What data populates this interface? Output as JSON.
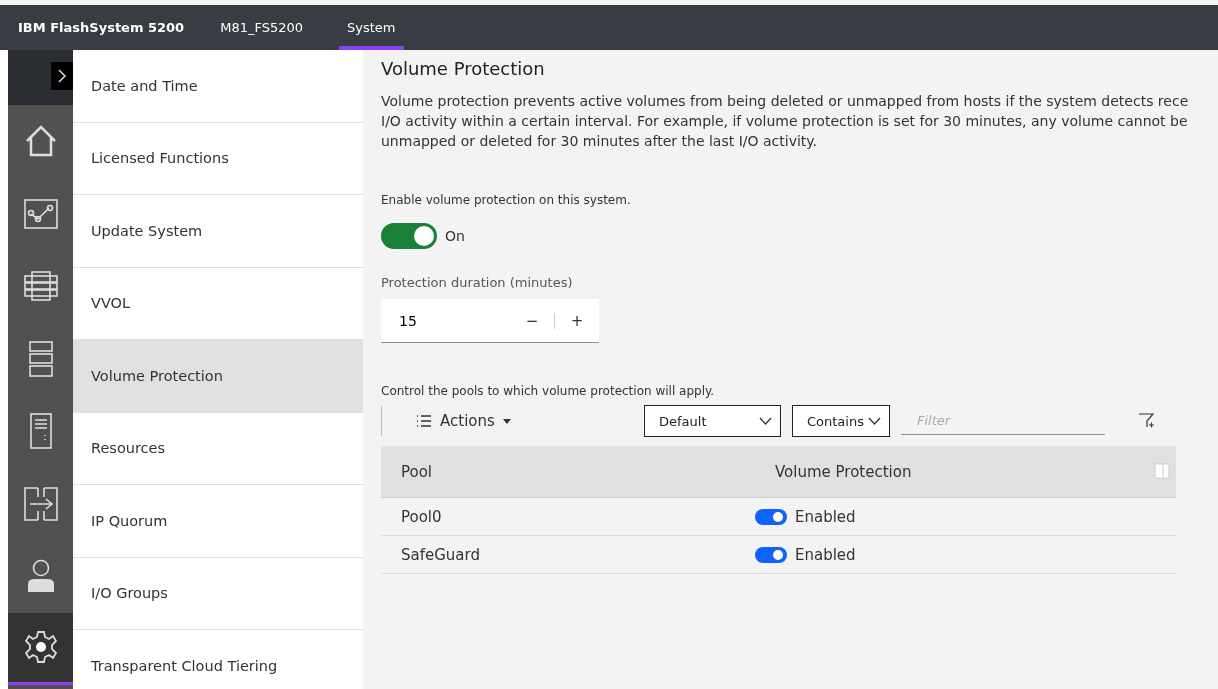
{
  "top_bar": {
    "product": "IBM FlashSystem 5200",
    "system_name": "M81_FS5200",
    "tabs": [
      {
        "label": "System",
        "selected": true
      }
    ]
  },
  "rail": {
    "items": [
      {
        "kind": "home",
        "selected": false
      },
      {
        "kind": "monitoring",
        "selected": false
      },
      {
        "kind": "pools",
        "selected": false
      },
      {
        "kind": "volumes",
        "selected": false
      },
      {
        "kind": "hosts",
        "selected": false
      },
      {
        "kind": "copy",
        "selected": false
      },
      {
        "kind": "access",
        "selected": false
      },
      {
        "kind": "settings",
        "selected": true
      }
    ]
  },
  "nav": {
    "items": [
      {
        "label": "Date and Time",
        "selected": false
      },
      {
        "label": "Licensed Functions",
        "selected": false
      },
      {
        "label": "Update System",
        "selected": false
      },
      {
        "label": "VVOL",
        "selected": false
      },
      {
        "label": "Volume Protection",
        "selected": true
      },
      {
        "label": "Resources",
        "selected": false
      },
      {
        "label": "IP Quorum",
        "selected": false
      },
      {
        "label": "I/O Groups",
        "selected": false
      },
      {
        "label": "Transparent Cloud Tiering",
        "selected": false
      }
    ]
  },
  "content": {
    "title": "Volume Protection",
    "description_lines": [
      "Volume protection prevents active volumes from being deleted or unmapped from hosts if the system detects rece",
      "I/O activity within a certain interval. For example, if volume protection is set for 30 minutes, any volume cannot be",
      "unmapped or deleted for 30 minutes after the last I/O activity."
    ],
    "enable_label": "Enable volume protection on this system.",
    "toggle": {
      "on": true,
      "label": "On"
    },
    "duration": {
      "label": "Protection duration (minutes)",
      "value": "15",
      "minus": "−",
      "plus": "+"
    },
    "pools_label": "Control the pools to which volume protection will apply.",
    "toolbar": {
      "actions": "Actions",
      "view_select": "Default",
      "match_select": "Contains",
      "filter_placeholder": "Filter"
    },
    "table": {
      "columns": [
        "Pool",
        "Volume Protection"
      ],
      "rows": [
        {
          "pool": "Pool0",
          "on": true,
          "status": "Enabled"
        },
        {
          "pool": "SafeGuard",
          "on": true,
          "status": "Enabled"
        }
      ]
    }
  }
}
